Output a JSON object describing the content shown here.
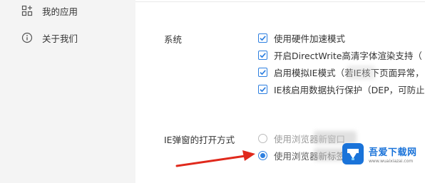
{
  "sidebar": {
    "items": [
      {
        "label": "我的应用",
        "icon": "apps-grid-icon"
      },
      {
        "label": "关于我们",
        "icon": "info-circle-icon"
      }
    ]
  },
  "settings": {
    "system": {
      "label": "系统",
      "options": [
        {
          "label": "使用硬件加速模式",
          "checked": true
        },
        {
          "label": "开启DirectWrite高清字体渲染支持（",
          "checked": true
        },
        {
          "label": "启用模拟IE模式（若IE核下页面异常，",
          "checked": true
        },
        {
          "label": "IE核启用数据执行保护（DEP，可防止",
          "checked": true
        }
      ]
    },
    "ie_popup": {
      "label": "IE弹窗的打开方式",
      "options": [
        {
          "label": "使用浏览器新窗口",
          "selected": false
        },
        {
          "label": "使用浏览器新标签",
          "selected": true
        }
      ]
    }
  },
  "colors": {
    "accent": "#2d7fe0",
    "arrow": "#e0291c",
    "sidebar_bg": "#f4f4f4"
  },
  "watermark": {
    "title": "吾爱下载网",
    "url": "www.wuaixiazai.com"
  }
}
